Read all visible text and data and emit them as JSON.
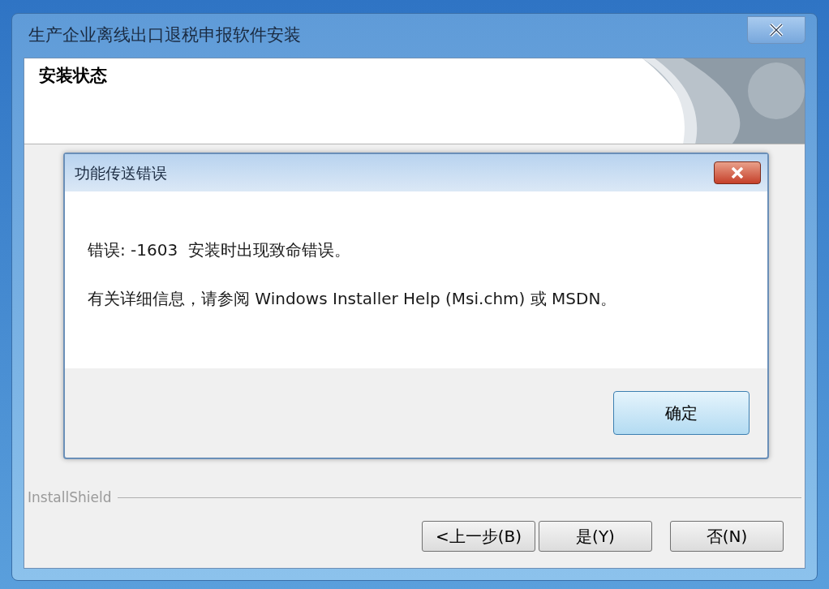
{
  "window": {
    "title": "生产企业离线出口退税申报软件安装"
  },
  "header": {
    "title": "安装状态"
  },
  "dialog": {
    "title": "功能传送错误",
    "messages": [
      "错误: -1603  安装时出现致命错误。",
      "有关详细信息，请参阅 Windows Installer Help (Msi.chm) 或 MSDN。"
    ],
    "ok_button": "确定"
  },
  "footer": {
    "brand": "InstallShield",
    "buttons": [
      {
        "label": "<上一步(B)"
      },
      {
        "label": "是(Y)"
      },
      {
        "label": "否(N)"
      }
    ]
  }
}
